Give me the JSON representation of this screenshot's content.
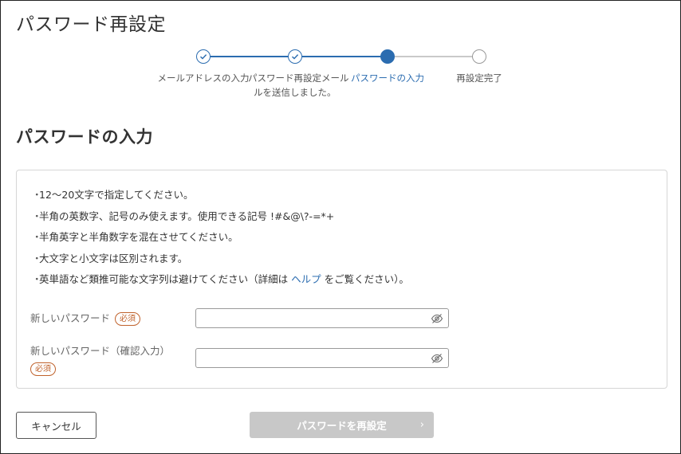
{
  "page": {
    "title": "パスワード再設定"
  },
  "stepper": {
    "steps": [
      {
        "label": "メールアドレスの入力",
        "state": "done"
      },
      {
        "label_line1": "パスワード再設定メール",
        "label_line2": "ルを送信しました。",
        "state": "done"
      },
      {
        "label": "パスワードの入力",
        "state": "active"
      },
      {
        "label": "再設定完了",
        "state": "todo"
      }
    ]
  },
  "section": {
    "title": "パスワードの入力"
  },
  "rules": [
    {
      "text": "12〜20文字で指定してください。"
    },
    {
      "text": "半角の英数字、記号のみ使えます。使用できる記号 !#&@\\?-=*+"
    },
    {
      "text": "半角英字と半角数字を混在させてください。"
    },
    {
      "text": "大文字と小文字は区別されます。"
    },
    {
      "text_before": "英単語など類推可能な文字列は避けてください（詳細は ",
      "link": "ヘルプ",
      "text_after": " をご覧ください）。"
    }
  ],
  "form": {
    "new_password": {
      "label": "新しいパスワード",
      "badge": "必須",
      "value": "",
      "icon": "eye-slash-icon"
    },
    "confirm_password": {
      "label": "新しいパスワード（確認入力）",
      "badge": "必須",
      "value": "",
      "icon": "eye-slash-icon"
    }
  },
  "actions": {
    "cancel_label": "キャンセル",
    "submit_label": "パスワードを再設定",
    "submit_chevron": "›",
    "submit_enabled": false
  },
  "colors": {
    "accent": "#2b6cb0",
    "required": "#c0622c",
    "disabled_button": "#c8c8c8"
  }
}
